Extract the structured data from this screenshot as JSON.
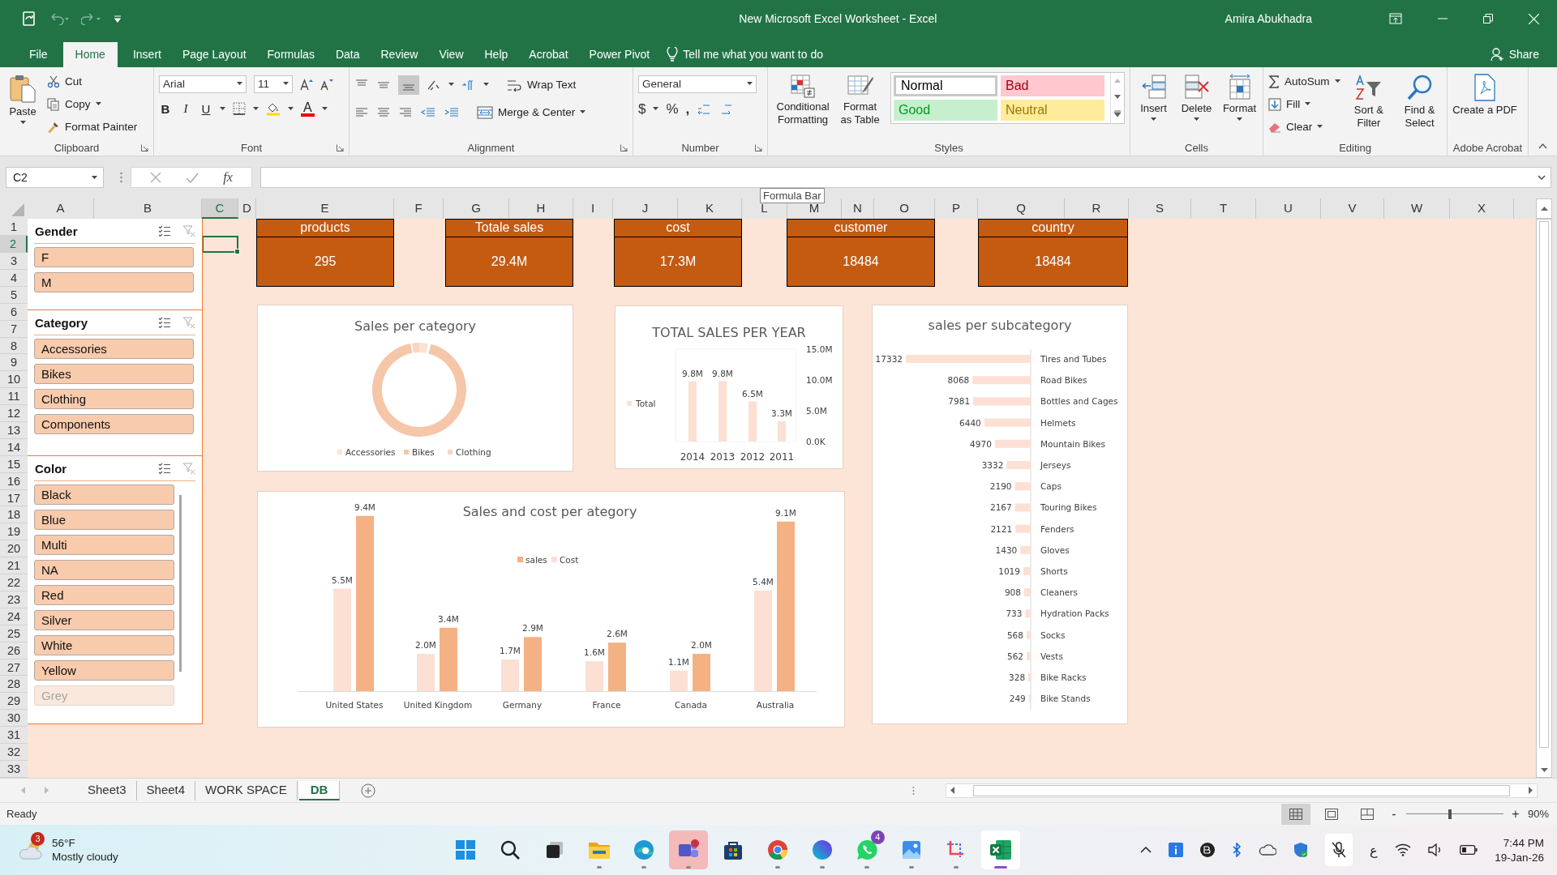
{
  "title_bar": {
    "title": "New Microsoft Excel Worksheet  -  Excel",
    "user": "Amira Abukhadra"
  },
  "ribbon_tabs": [
    {
      "label": "File",
      "selected": false
    },
    {
      "label": "Home",
      "selected": true
    },
    {
      "label": "Insert",
      "selected": false
    },
    {
      "label": "Page Layout",
      "selected": false
    },
    {
      "label": "Formulas",
      "selected": false
    },
    {
      "label": "Data",
      "selected": false
    },
    {
      "label": "Review",
      "selected": false
    },
    {
      "label": "View",
      "selected": false
    },
    {
      "label": "Help",
      "selected": false
    },
    {
      "label": "Acrobat",
      "selected": false
    },
    {
      "label": "Power Pivot",
      "selected": false
    }
  ],
  "tell_me": "Tell me what you want to do",
  "share": "Share",
  "ribbon": {
    "clipboard": {
      "paste": "Paste",
      "cut": "Cut",
      "copy": "Copy",
      "format_painter": "Format Painter",
      "label": "Clipboard"
    },
    "font": {
      "font_name": "Arial",
      "font_size": "11",
      "bold": "B",
      "italic": "I",
      "underline": "U",
      "font_color": "A",
      "label": "Font"
    },
    "alignment": {
      "wrap_text": "Wrap Text",
      "merge_center": "Merge & Center",
      "label": "Alignment"
    },
    "number": {
      "format": "General",
      "currency": "$",
      "percent": "%",
      "comma": ",",
      "label": "Number"
    },
    "styles": {
      "conditional_formatting": "Conditional Formatting",
      "format_as_table": "Format as Table",
      "label": "Styles",
      "cell_styles": [
        {
          "label": "Normal",
          "color": "#ffffff",
          "selected": true
        },
        {
          "label": "Bad",
          "color": "#ffc7ce",
          "selected": false
        },
        {
          "label": "Good",
          "color": "#c6efce",
          "selected": false
        },
        {
          "label": "Neutral",
          "color": "#ffeb9c",
          "selected": false
        }
      ]
    },
    "cells": {
      "buttons": [
        "Insert",
        "Delete",
        "Format"
      ],
      "label": "Cells"
    },
    "editing": {
      "autosum": "AutoSum",
      "fill": "Fill",
      "clear": "Clear",
      "sort_filter": "Sort & Filter",
      "find_select": "Find & Select",
      "label": "Editing"
    },
    "adobe": {
      "create_pdf": "Create a PDF",
      "label": "Adobe Acrobat"
    }
  },
  "formula_bar": {
    "name_box": "C2",
    "function_label": "fx",
    "tooltip": "Formula Bar"
  },
  "columns": [
    {
      "label": "A",
      "selected": false
    },
    {
      "label": "B",
      "selected": false
    },
    {
      "label": "C",
      "selected": true
    },
    {
      "label": "D",
      "selected": false
    },
    {
      "label": "E",
      "selected": false
    },
    {
      "label": "F",
      "selected": false
    },
    {
      "label": "G",
      "selected": false
    },
    {
      "label": "H",
      "selected": false
    },
    {
      "label": "I",
      "selected": false
    },
    {
      "label": "J",
      "selected": false
    },
    {
      "label": "K",
      "selected": false
    },
    {
      "label": "L",
      "selected": false
    },
    {
      "label": "M",
      "selected": false
    },
    {
      "label": "N",
      "selected": false
    },
    {
      "label": "O",
      "selected": false
    },
    {
      "label": "P",
      "selected": false
    },
    {
      "label": "Q",
      "selected": false
    },
    {
      "label": "R",
      "selected": false
    },
    {
      "label": "S",
      "selected": false
    },
    {
      "label": "T",
      "selected": false
    },
    {
      "label": "U",
      "selected": false
    },
    {
      "label": "V",
      "selected": false
    },
    {
      "label": "W",
      "selected": false
    },
    {
      "label": "X",
      "selected": false
    }
  ],
  "rows": [
    {
      "label": "1",
      "selected": false
    },
    {
      "label": "2",
      "selected": true
    },
    {
      "label": "3",
      "selected": false
    },
    {
      "label": "4",
      "selected": false
    },
    {
      "label": "5",
      "selected": false
    },
    {
      "label": "6",
      "selected": false
    },
    {
      "label": "7",
      "selected": false
    },
    {
      "label": "8",
      "selected": false
    },
    {
      "label": "9",
      "selected": false
    },
    {
      "label": "10",
      "selected": false
    },
    {
      "label": "11",
      "selected": false
    },
    {
      "label": "12",
      "selected": false
    },
    {
      "label": "13",
      "selected": false
    },
    {
      "label": "14",
      "selected": false
    },
    {
      "label": "15",
      "selected": false
    },
    {
      "label": "16",
      "selected": false
    },
    {
      "label": "17",
      "selected": false
    },
    {
      "label": "18",
      "selected": false
    },
    {
      "label": "19",
      "selected": false
    },
    {
      "label": "20",
      "selected": false
    },
    {
      "label": "21",
      "selected": false
    },
    {
      "label": "22",
      "selected": false
    },
    {
      "label": "23",
      "selected": false
    },
    {
      "label": "24",
      "selected": false
    },
    {
      "label": "25",
      "selected": false
    },
    {
      "label": "26",
      "selected": false
    },
    {
      "label": "27",
      "selected": false
    },
    {
      "label": "28",
      "selected": false
    },
    {
      "label": "29",
      "selected": false
    },
    {
      "label": "30",
      "selected": false
    },
    {
      "label": "31",
      "selected": false
    },
    {
      "label": "32",
      "selected": false
    },
    {
      "label": "33",
      "selected": false
    }
  ],
  "slicers": [
    {
      "title": "Gender",
      "items": [
        {
          "label": "F",
          "disabled": false
        },
        {
          "label": "M",
          "disabled": false
        }
      ]
    },
    {
      "title": "Category",
      "items": [
        {
          "label": "Accessories",
          "disabled": false
        },
        {
          "label": "Bikes",
          "disabled": false
        },
        {
          "label": "Clothing",
          "disabled": false
        },
        {
          "label": "Components",
          "disabled": false
        }
      ]
    },
    {
      "title": "Color",
      "items": [
        {
          "label": "Black",
          "disabled": false
        },
        {
          "label": "Blue",
          "disabled": false
        },
        {
          "label": "Multi",
          "disabled": false
        },
        {
          "label": "NA",
          "disabled": false
        },
        {
          "label": "Red",
          "disabled": false
        },
        {
          "label": "Silver",
          "disabled": false
        },
        {
          "label": "White",
          "disabled": false
        },
        {
          "label": "Yellow",
          "disabled": false
        },
        {
          "label": "Grey",
          "disabled": true
        }
      ]
    }
  ],
  "kpis": [
    {
      "title": "products",
      "value": "295"
    },
    {
      "title": "Totale sales",
      "value": "29.4M"
    },
    {
      "title": "cost",
      "value": "17.3M"
    },
    {
      "title": "customer",
      "value": "18484"
    },
    {
      "title": "country",
      "value": "18484"
    }
  ],
  "category_chart": {
    "title": "Sales per category",
    "legend": [
      {
        "label": "Accessories",
        "color": "#fbe3d4"
      },
      {
        "label": "Bikes",
        "color": "#f6c6a8"
      },
      {
        "label": "Clothing",
        "color": "#f9d6c0"
      }
    ]
  },
  "year_chart": {
    "chart_data": {
      "type": "bar",
      "title": "TOTAL SALES PER YEAR",
      "categories": [
        "2014",
        "2013",
        "2012",
        "2011"
      ],
      "series": [
        {
          "name": "Total",
          "color": "#fbe0d3",
          "values": [
            9.8,
            9.8,
            6.5,
            3.3
          ]
        }
      ],
      "ylim": [
        0,
        15
      ],
      "yticks": [
        {
          "value": 0,
          "label": "0.0K"
        },
        {
          "value": 5,
          "label": "5.0M"
        },
        {
          "value": 10,
          "label": "10.0M"
        },
        {
          "value": 15,
          "label": "15.0M"
        }
      ],
      "value_labels": [
        "9.8M",
        "9.8M",
        "6.5M",
        "3.3M"
      ]
    }
  },
  "subcategory_chart": {
    "chart_data": {
      "type": "bar",
      "orientation": "horizontal",
      "title": "sales per subcategory",
      "data_labels": true,
      "categories": [
        "Tires and Tubes",
        "Road Bikes",
        "Bottles and Cages",
        "Helmets",
        "Mountain Bikes",
        "Jerseys",
        "Caps",
        "Touring Bikes",
        "Fenders",
        "Gloves",
        "Shorts",
        "Cleaners",
        "Hydration Packs",
        "Socks",
        "Vests",
        "Bike Racks",
        "Bike Stands"
      ],
      "series": [
        {
          "color": "#fbe0d3",
          "values": [
            17332,
            8068,
            7981,
            6440,
            4970,
            3332,
            2190,
            2167,
            2121,
            1430,
            1019,
            908,
            733,
            568,
            562,
            328,
            249
          ]
        }
      ]
    }
  },
  "country_chart": {
    "chart_data": {
      "type": "bar",
      "title": "Sales and cost per ategory",
      "legend": "top",
      "categories": [
        "United States",
        "United Kingdom",
        "Germany",
        "France",
        "Canada",
        "Australia"
      ],
      "series": [
        {
          "name": "sales",
          "color": "#f4b183",
          "values": [
            9.4,
            3.4,
            2.9,
            2.6,
            2.0,
            9.1
          ],
          "value_labels": [
            "9.4M",
            "3.4M",
            "2.9M",
            "2.6M",
            "2.0M",
            "9.1M"
          ]
        },
        {
          "name": "Cost",
          "color": "#fbe0d3",
          "values": [
            5.5,
            2.0,
            1.7,
            1.6,
            1.1,
            5.4
          ],
          "value_labels": [
            "5.5M",
            "2.0M",
            "1.7M",
            "1.6M",
            "1.1M",
            "5.4M"
          ]
        }
      ]
    }
  },
  "sheet_tabs": [
    {
      "label": "Sheet3",
      "selected": false
    },
    {
      "label": "Sheet4",
      "selected": false
    },
    {
      "label": "WORK SPACE",
      "selected": false
    },
    {
      "label": "DB",
      "selected": true
    }
  ],
  "status_bar": {
    "text": "Ready",
    "views": [
      {
        "selected": true
      },
      {
        "selected": false
      },
      {
        "selected": false
      }
    ],
    "zoom_minus": "-",
    "zoom_plus": "+",
    "zoom": {
      "level": 0.45
    },
    "zoom_text": "90%"
  },
  "taskbar": {
    "weather": {
      "badge": "3",
      "temperature": "56°F",
      "condition": "Mostly cloudy"
    },
    "apps": [
      {
        "kind": "start",
        "open": false,
        "active": false,
        "alert": false
      },
      {
        "kind": "search",
        "open": false,
        "active": false,
        "alert": false
      },
      {
        "kind": "taskview",
        "open": false,
        "active": false,
        "alert": false
      },
      {
        "kind": "folder",
        "open": true,
        "active": false,
        "alert": false
      },
      {
        "kind": "browser",
        "open": true,
        "active": false,
        "alert": false
      },
      {
        "kind": "meeting",
        "open": true,
        "active": false,
        "alert": true
      },
      {
        "kind": "store",
        "open": false,
        "active": false,
        "alert": false
      },
      {
        "kind": "globe",
        "open": true,
        "active": false,
        "alert": false
      },
      {
        "kind": "design",
        "open": true,
        "active": false,
        "alert": false
      },
      {
        "kind": "chat",
        "open": true,
        "active": false,
        "alert": false,
        "badge": "4"
      },
      {
        "kind": "photos",
        "open": true,
        "active": false,
        "alert": false
      },
      {
        "kind": "snip",
        "open": true,
        "active": false,
        "alert": false
      },
      {
        "kind": "sheet",
        "open": true,
        "active": true,
        "alert": false
      }
    ],
    "language": "ع",
    "time": "7:44 PM",
    "date": "19-Jan-26"
  }
}
